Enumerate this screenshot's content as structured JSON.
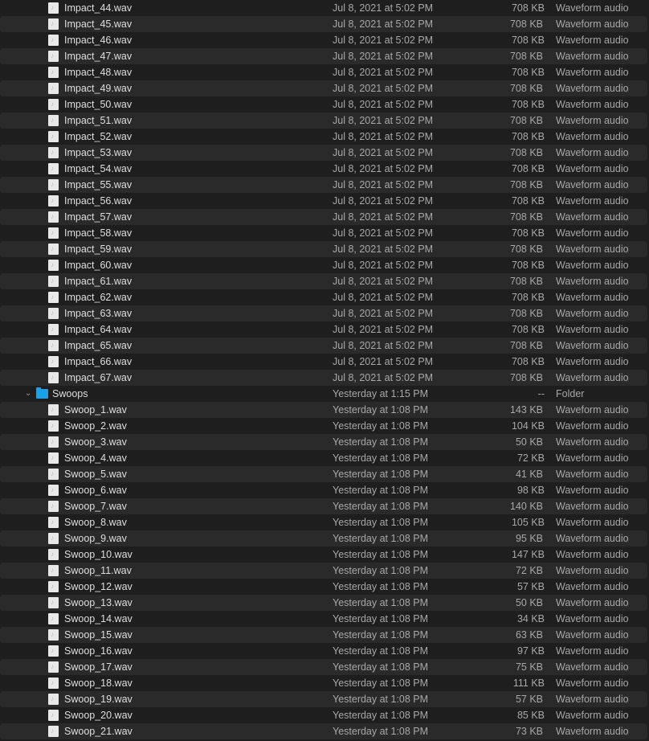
{
  "rows": [
    {
      "name": "Impact_44.wav",
      "date": "Jul 8, 2021 at 5:02 PM",
      "size": "708 KB",
      "kind": "Waveform audio"
    },
    {
      "name": "Impact_45.wav",
      "date": "Jul 8, 2021 at 5:02 PM",
      "size": "708 KB",
      "kind": "Waveform audio"
    },
    {
      "name": "Impact_46.wav",
      "date": "Jul 8, 2021 at 5:02 PM",
      "size": "708 KB",
      "kind": "Waveform audio"
    },
    {
      "name": "Impact_47.wav",
      "date": "Jul 8, 2021 at 5:02 PM",
      "size": "708 KB",
      "kind": "Waveform audio"
    },
    {
      "name": "Impact_48.wav",
      "date": "Jul 8, 2021 at 5:02 PM",
      "size": "708 KB",
      "kind": "Waveform audio"
    },
    {
      "name": "Impact_49.wav",
      "date": "Jul 8, 2021 at 5:02 PM",
      "size": "708 KB",
      "kind": "Waveform audio"
    },
    {
      "name": "Impact_50.wav",
      "date": "Jul 8, 2021 at 5:02 PM",
      "size": "708 KB",
      "kind": "Waveform audio"
    },
    {
      "name": "Impact_51.wav",
      "date": "Jul 8, 2021 at 5:02 PM",
      "size": "708 KB",
      "kind": "Waveform audio"
    },
    {
      "name": "Impact_52.wav",
      "date": "Jul 8, 2021 at 5:02 PM",
      "size": "708 KB",
      "kind": "Waveform audio"
    },
    {
      "name": "Impact_53.wav",
      "date": "Jul 8, 2021 at 5:02 PM",
      "size": "708 KB",
      "kind": "Waveform audio"
    },
    {
      "name": "Impact_54.wav",
      "date": "Jul 8, 2021 at 5:02 PM",
      "size": "708 KB",
      "kind": "Waveform audio"
    },
    {
      "name": "Impact_55.wav",
      "date": "Jul 8, 2021 at 5:02 PM",
      "size": "708 KB",
      "kind": "Waveform audio"
    },
    {
      "name": "Impact_56.wav",
      "date": "Jul 8, 2021 at 5:02 PM",
      "size": "708 KB",
      "kind": "Waveform audio"
    },
    {
      "name": "Impact_57.wav",
      "date": "Jul 8, 2021 at 5:02 PM",
      "size": "708 KB",
      "kind": "Waveform audio"
    },
    {
      "name": "Impact_58.wav",
      "date": "Jul 8, 2021 at 5:02 PM",
      "size": "708 KB",
      "kind": "Waveform audio"
    },
    {
      "name": "Impact_59.wav",
      "date": "Jul 8, 2021 at 5:02 PM",
      "size": "708 KB",
      "kind": "Waveform audio"
    },
    {
      "name": "Impact_60.wav",
      "date": "Jul 8, 2021 at 5:02 PM",
      "size": "708 KB",
      "kind": "Waveform audio"
    },
    {
      "name": "Impact_61.wav",
      "date": "Jul 8, 2021 at 5:02 PM",
      "size": "708 KB",
      "kind": "Waveform audio"
    },
    {
      "name": "Impact_62.wav",
      "date": "Jul 8, 2021 at 5:02 PM",
      "size": "708 KB",
      "kind": "Waveform audio"
    },
    {
      "name": "Impact_63.wav",
      "date": "Jul 8, 2021 at 5:02 PM",
      "size": "708 KB",
      "kind": "Waveform audio"
    },
    {
      "name": "Impact_64.wav",
      "date": "Jul 8, 2021 at 5:02 PM",
      "size": "708 KB",
      "kind": "Waveform audio"
    },
    {
      "name": "Impact_65.wav",
      "date": "Jul 8, 2021 at 5:02 PM",
      "size": "708 KB",
      "kind": "Waveform audio"
    },
    {
      "name": "Impact_66.wav",
      "date": "Jul 8, 2021 at 5:02 PM",
      "size": "708 KB",
      "kind": "Waveform audio"
    },
    {
      "name": "Impact_67.wav",
      "date": "Jul 8, 2021 at 5:02 PM",
      "size": "708 KB",
      "kind": "Waveform audio"
    },
    {
      "name": "Swoops",
      "date": "Yesterday at 1:15 PM",
      "size": "--",
      "kind": "Folder",
      "folder": true,
      "expanded": true,
      "icon": "folder-icon",
      "color": "#1aa1e8"
    },
    {
      "name": "Swoop_1.wav",
      "date": "Yesterday at 1:08 PM",
      "size": "143 KB",
      "kind": "Waveform audio"
    },
    {
      "name": "Swoop_2.wav",
      "date": "Yesterday at 1:08 PM",
      "size": "104 KB",
      "kind": "Waveform audio"
    },
    {
      "name": "Swoop_3.wav",
      "date": "Yesterday at 1:08 PM",
      "size": "50 KB",
      "kind": "Waveform audio"
    },
    {
      "name": "Swoop_4.wav",
      "date": "Yesterday at 1:08 PM",
      "size": "72 KB",
      "kind": "Waveform audio"
    },
    {
      "name": "Swoop_5.wav",
      "date": "Yesterday at 1:08 PM",
      "size": "41 KB",
      "kind": "Waveform audio"
    },
    {
      "name": "Swoop_6.wav",
      "date": "Yesterday at 1:08 PM",
      "size": "98 KB",
      "kind": "Waveform audio"
    },
    {
      "name": "Swoop_7.wav",
      "date": "Yesterday at 1:08 PM",
      "size": "140 KB",
      "kind": "Waveform audio"
    },
    {
      "name": "Swoop_8.wav",
      "date": "Yesterday at 1:08 PM",
      "size": "105 KB",
      "kind": "Waveform audio"
    },
    {
      "name": "Swoop_9.wav",
      "date": "Yesterday at 1:08 PM",
      "size": "95 KB",
      "kind": "Waveform audio"
    },
    {
      "name": "Swoop_10.wav",
      "date": "Yesterday at 1:08 PM",
      "size": "147 KB",
      "kind": "Waveform audio"
    },
    {
      "name": "Swoop_11.wav",
      "date": "Yesterday at 1:08 PM",
      "size": "72 KB",
      "kind": "Waveform audio"
    },
    {
      "name": "Swoop_12.wav",
      "date": "Yesterday at 1:08 PM",
      "size": "57 KB",
      "kind": "Waveform audio"
    },
    {
      "name": "Swoop_13.wav",
      "date": "Yesterday at 1:08 PM",
      "size": "50 KB",
      "kind": "Waveform audio"
    },
    {
      "name": "Swoop_14.wav",
      "date": "Yesterday at 1:08 PM",
      "size": "34 KB",
      "kind": "Waveform audio"
    },
    {
      "name": "Swoop_15.wav",
      "date": "Yesterday at 1:08 PM",
      "size": "63 KB",
      "kind": "Waveform audio"
    },
    {
      "name": "Swoop_16.wav",
      "date": "Yesterday at 1:08 PM",
      "size": "97 KB",
      "kind": "Waveform audio"
    },
    {
      "name": "Swoop_17.wav",
      "date": "Yesterday at 1:08 PM",
      "size": "75 KB",
      "kind": "Waveform audio"
    },
    {
      "name": "Swoop_18.wav",
      "date": "Yesterday at 1:08 PM",
      "size": "111 KB",
      "kind": "Waveform audio"
    },
    {
      "name": "Swoop_19.wav",
      "date": "Yesterday at 1:08 PM",
      "size": "57 KB",
      "kind": "Waveform audio"
    },
    {
      "name": "Swoop_20.wav",
      "date": "Yesterday at 1:08 PM",
      "size": "85 KB",
      "kind": "Waveform audio"
    },
    {
      "name": "Swoop_21.wav",
      "date": "Yesterday at 1:08 PM",
      "size": "73 KB",
      "kind": "Waveform audio"
    }
  ]
}
